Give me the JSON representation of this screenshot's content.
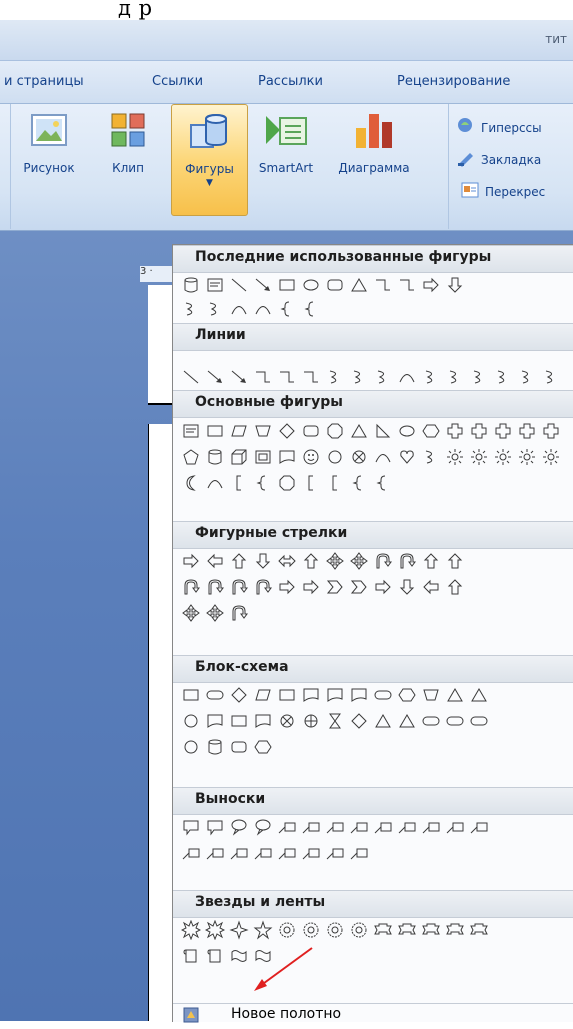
{
  "caption": {
    "fragment": "д                          р"
  },
  "titlebar": {
    "title_fragment": "тит"
  },
  "ribbon_tabs": [
    {
      "label": "и страницы"
    },
    {
      "label": "Ссылки"
    },
    {
      "label": "Рассылки"
    },
    {
      "label": "Рецензирование"
    }
  ],
  "ribbon": {
    "buttons": [
      {
        "label": "Рисунок",
        "icon": "picture-icon"
      },
      {
        "label": "Клип",
        "icon": "clipart-icon"
      },
      {
        "label": "Фигуры",
        "icon": "shapes-icon"
      },
      {
        "label": "SmartArt",
        "icon": "smartart-icon"
      },
      {
        "label": "Диаграмма",
        "icon": "chart-icon"
      }
    ],
    "links": [
      {
        "label": "Гиперссы",
        "icon": "hyperlink-icon"
      },
      {
        "label": "Закладка",
        "icon": "bookmark-icon"
      },
      {
        "label": "Перекрес",
        "icon": "crossref-icon"
      }
    ]
  },
  "ruler": {
    "marker": "3 ·"
  },
  "shapes_menu": {
    "sections": [
      {
        "title": "Последние использованные фигуры"
      },
      {
        "title": "Линии"
      },
      {
        "title": "Основные фигуры"
      },
      {
        "title": "Фигурные стрелки"
      },
      {
        "title": "Блок-схема"
      },
      {
        "title": "Выноски"
      },
      {
        "title": "Звезды и ленты"
      }
    ],
    "footer": {
      "label": "Новое полотно",
      "icon": "new-canvas-icon"
    }
  },
  "colors": {
    "accent": "#15428b",
    "highlight": "#f7c766",
    "annotation_arrow": "#e02020"
  }
}
